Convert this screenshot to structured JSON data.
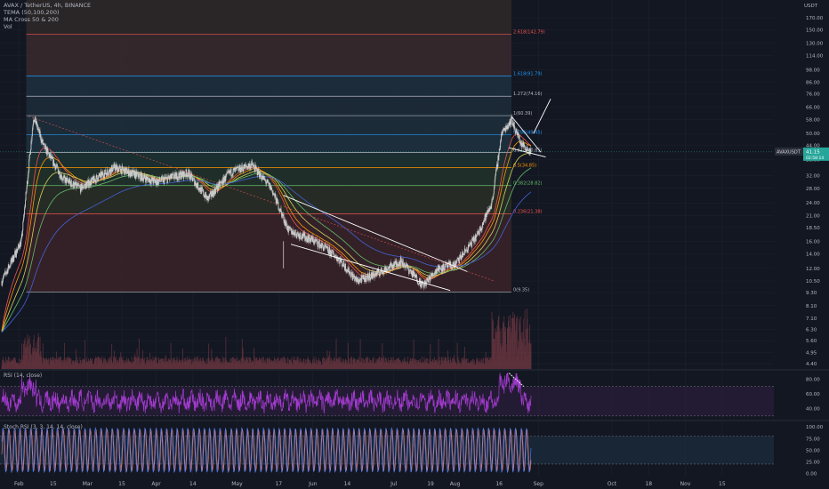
{
  "legend": {
    "symbol": "AVAX / TetherUS, 4h, BINANCE",
    "indicators": [
      "TEMA (50,100,200)",
      "MA Cross 50 & 200",
      "Vol"
    ]
  },
  "panes": {
    "rsi_label": "RSI (14, close)",
    "stoch_label": "Stoch RSI (3, 3, 14, 14, close)"
  },
  "currency": "USDT",
  "price_tag": {
    "symbol": "AVAXUSDT",
    "value": "41.15",
    "countdown": "02:58:14",
    "price": 41.15
  },
  "colors": {
    "background": "#131722",
    "grid": "#1e222d",
    "candle": "#c9c9c9",
    "ema_red": "#ef5350",
    "ema_orange": "#ff9800",
    "ema_yellow": "#d4d45a",
    "ema_green": "#66bb6a",
    "ema_blue": "#4363d8",
    "rsi": "#a33bd0",
    "stoch_k": "#4f83ff",
    "stoch_d": "#ff7a59"
  },
  "chart_data": {
    "type": "candlestick",
    "y_scale": "log",
    "ylim": [
      9.3,
      170
    ],
    "y_ticks": [
      "170.00",
      "150.00",
      "130.00",
      "114.00",
      "98.00",
      "86.00",
      "76.00",
      "66.00",
      "58.00",
      "50.00",
      "44.00",
      "38.00",
      "32.00",
      "28.00",
      "24.00",
      "21.00",
      "18.50",
      "16.00",
      "14.00",
      "12.00",
      "10.50",
      "9.30",
      "8.10",
      "7.10",
      "6.30",
      "5.60",
      "4.95",
      "4.40"
    ],
    "x_ticks": [
      "Feb",
      "15",
      "Mar",
      "15",
      "Apr",
      "14",
      "May",
      "17",
      "Jun",
      "14",
      "Jul",
      "19",
      "Aug",
      "16",
      "Sep",
      "Oct",
      "18",
      "Nov",
      "15"
    ],
    "price_path": [
      {
        "x": "Jan 28",
        "y": 10.5
      },
      {
        "x": "Feb 5",
        "y": 16
      },
      {
        "x": "Feb 10",
        "y": 60
      },
      {
        "x": "Feb 14",
        "y": 44
      },
      {
        "x": "Feb 22",
        "y": 31
      },
      {
        "x": "Mar 1",
        "y": 28
      },
      {
        "x": "Mar 15",
        "y": 35
      },
      {
        "x": "Apr 1",
        "y": 30
      },
      {
        "x": "Apr 14",
        "y": 33
      },
      {
        "x": "Apr 22",
        "y": 25
      },
      {
        "x": "May 1",
        "y": 33
      },
      {
        "x": "May 10",
        "y": 36
      },
      {
        "x": "May 18",
        "y": 28
      },
      {
        "x": "May 25",
        "y": 18
      },
      {
        "x": "Jun 5",
        "y": 16
      },
      {
        "x": "Jun 14",
        "y": 13.5
      },
      {
        "x": "Jun 22",
        "y": 10.5
      },
      {
        "x": "Jul 1",
        "y": 11.5
      },
      {
        "x": "Jul 10",
        "y": 13
      },
      {
        "x": "Jul 19",
        "y": 10
      },
      {
        "x": "Jul 25",
        "y": 12
      },
      {
        "x": "Aug 1",
        "y": 12.5
      },
      {
        "x": "Aug 10",
        "y": 17
      },
      {
        "x": "Aug 16",
        "y": 24
      },
      {
        "x": "Aug 20",
        "y": 50
      },
      {
        "x": "Aug 24",
        "y": 58
      },
      {
        "x": "Aug 28",
        "y": 45
      },
      {
        "x": "Sep 1",
        "y": 41.15
      }
    ],
    "fib_levels": [
      {
        "label": "2.618(142.79)",
        "value": 142.79,
        "color": "#ef5350"
      },
      {
        "label": "1.618(91.79)",
        "value": 91.79,
        "color": "#2196f3"
      },
      {
        "label": "1.272(74.16)",
        "value": 74.16,
        "color": "#b2b5be"
      },
      {
        "label": "1(60.39)",
        "value": 60.39,
        "color": "#b2b5be"
      },
      {
        "label": "0.786(49.45)",
        "value": 49.45,
        "color": "#2196f3"
      },
      {
        "label": "0.618(40.85)",
        "value": 40.85,
        "color": "#b2b5be"
      },
      {
        "label": "0.5(34.85)",
        "value": 34.85,
        "color": "#ff9800"
      },
      {
        "label": "0.382(28.82)",
        "value": 28.82,
        "color": "#66bb6a"
      },
      {
        "label": "0.236(21.38)",
        "value": 21.38,
        "color": "#ef5350"
      },
      {
        "label": "0(9.35)",
        "value": 9.35,
        "color": "#b2b5be"
      }
    ],
    "rsi": {
      "ticks": [
        "80.00",
        "60.00",
        "40.00"
      ],
      "ylim": [
        25,
        90
      ],
      "bands": [
        70,
        30
      ]
    },
    "stoch_rsi": {
      "ticks": [
        "100.00",
        "75.00",
        "50.00",
        "25.00",
        "0.00"
      ],
      "ylim": [
        -5,
        110
      ],
      "bands": [
        80,
        20
      ]
    }
  }
}
